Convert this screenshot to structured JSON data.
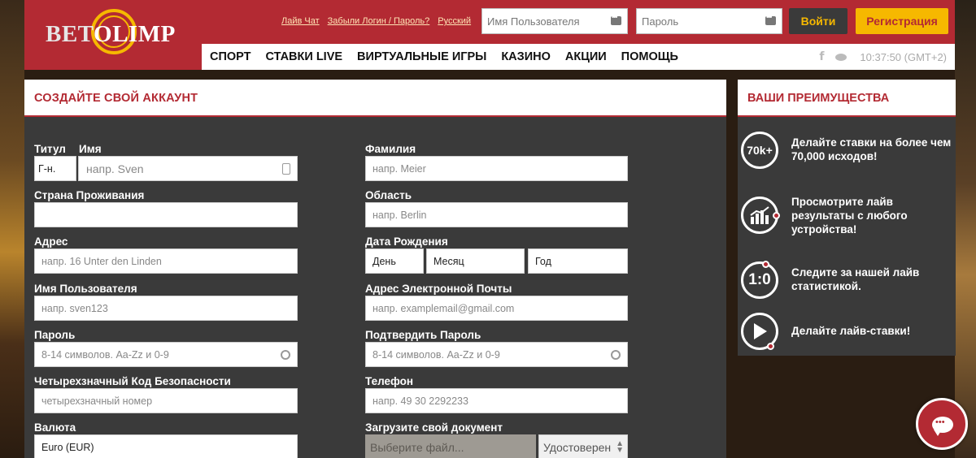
{
  "header": {
    "logo_bet": "BET",
    "logo_olimp": "OLIMP",
    "links": [
      "Лайв Чат",
      "Забыли Логин / Пароль?",
      "Русский"
    ],
    "username_placeholder": "Имя Пользователя",
    "password_placeholder": "Пароль",
    "login_label": "Войти",
    "register_label": "Регистрация"
  },
  "nav": {
    "items": [
      "СПОРТ",
      "СТАВКИ LIVE",
      "ВИРТУАЛЬНЫЕ ИГРЫ",
      "КАЗИНО",
      "АКЦИИ",
      "ПОМОЩЬ"
    ],
    "facebook_glyph": "f",
    "time": "10:37:50 (GMT+2)"
  },
  "form": {
    "title": "СОЗДАЙТЕ СВОЙ АККАУНТ",
    "title_label": "Титул",
    "title_value": "Г-н.",
    "first_name_label": "Имя",
    "first_name_placeholder": "напр. Sven",
    "last_name_label": "Фамилия",
    "last_name_placeholder": "напр. Meier",
    "country_label": "Страна Проживания",
    "country_value": "",
    "region_label": "Область",
    "region_placeholder": "напр. Berlin",
    "address_label": "Адрес",
    "address_placeholder": "напр. 16 Unter den Linden",
    "dob_label": "Дата Рождения",
    "dob_day": "День",
    "dob_month": "Месяц",
    "dob_year": "Год",
    "username_label": "Имя Пользователя",
    "username_placeholder": "напр. sven123",
    "email_label": "Адрес Электронной Почты",
    "email_placeholder": "напр.  examplemail@gmail.com",
    "password_label": "Пароль",
    "password_placeholder": "8-14 символов. Aa-Zz и 0-9",
    "confirm_label": "Подтвердить Пароль",
    "confirm_placeholder": "8-14 символов. Aa-Zz и 0-9",
    "code_label": "Четырехзначный Код Безопасности",
    "code_placeholder": "четырехзначный номер",
    "phone_label": "Телефон",
    "phone_placeholder": "напр. 49 30 2292233",
    "currency_label": "Валюта",
    "currency_value": "Euro (EUR)",
    "upload_label": "Загрузите свой документ",
    "upload_placeholder": "Выберите файл...",
    "doc_type": "Удостоверен"
  },
  "advantages": {
    "title": "ВАШИ ПРЕИМУЩЕСТВА",
    "items": [
      {
        "icon": "70k+",
        "text": "Делайте ставки на более чем 70,000 исходов!"
      },
      {
        "icon": "",
        "text": "Просмотрите лайв результаты с любого устройства!"
      },
      {
        "icon": "1:0",
        "text": "Следите за нашей лайв статистикой."
      },
      {
        "icon": "",
        "text": "Делайте лайв-ставки!"
      }
    ]
  }
}
